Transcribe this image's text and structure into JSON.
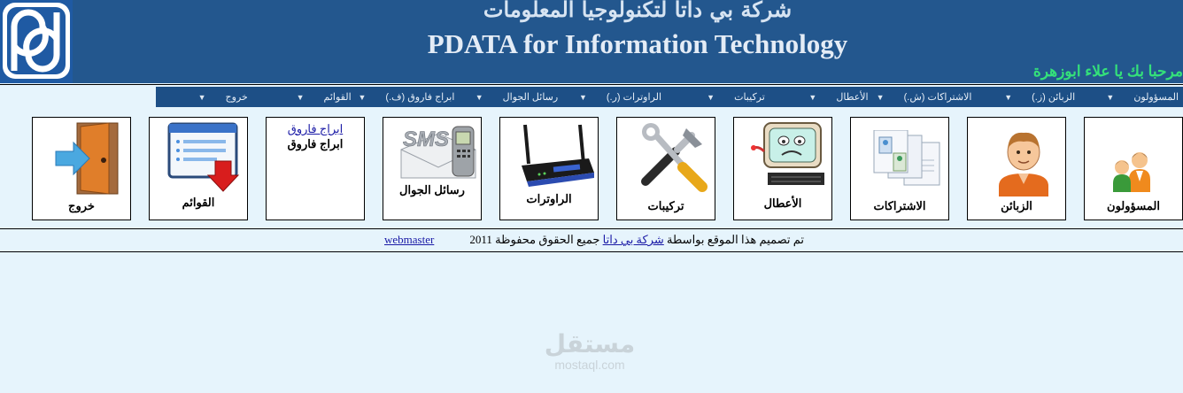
{
  "header": {
    "title_ar": "شركة بي داتا لتكنولوجيا المعلومات",
    "title_en": "PDATA for Information Technology",
    "welcome": "مرحبا بك يا علاء ابوزهرة",
    "logo_icon": "pdata-logo",
    "bg_color": "#23578e"
  },
  "menu": [
    {
      "label": "المسؤولون",
      "icon": "chevron-down-icon"
    },
    {
      "label": "الزبائن (ز.)",
      "icon": "chevron-down-icon"
    },
    {
      "label": "الاشتراكات (ش.)",
      "icon": "chevron-down-icon"
    },
    {
      "label": "الأعطال",
      "icon": "chevron-down-icon"
    },
    {
      "label": "تركيبات",
      "icon": "chevron-down-icon"
    },
    {
      "label": "الراوترات (ر.)",
      "icon": "chevron-down-icon"
    },
    {
      "label": "رسائل الجوال",
      "icon": "chevron-down-icon"
    },
    {
      "label": "ابراج فاروق (ف.)",
      "icon": "chevron-down-icon"
    },
    {
      "label": "القوائم",
      "icon": "chevron-down-icon"
    },
    {
      "label": "خروج",
      "icon": "chevron-down-icon"
    }
  ],
  "tiles": [
    {
      "label": "المسؤولون",
      "icon": "admins-icon"
    },
    {
      "label": "الزبائن",
      "icon": "customer-icon"
    },
    {
      "label": "الاشتراكات",
      "icon": "subscriptions-icon"
    },
    {
      "label": "الأعطال",
      "icon": "broken-computer-icon"
    },
    {
      "label": "تركيبات",
      "icon": "tools-icon"
    },
    {
      "label": "الراوترات",
      "icon": "router-icon"
    },
    {
      "label": "رسائل الجوال",
      "icon": "sms-icon"
    },
    {
      "label": "ابراج فاروق",
      "link": "ابراج فاروق",
      "icon": "none"
    },
    {
      "label": "القوائم",
      "icon": "lists-icon"
    },
    {
      "label": "خروج",
      "icon": "exit-door-icon"
    }
  ],
  "footer": {
    "prefix": "تم تصميم هذا الموقع بواسطة",
    "company_link": "شركة بي داتا",
    "suffix": "جميع الحقوق محفوظة 2011",
    "webmaster": "webmaster"
  },
  "watermark": {
    "ar": "مستقل",
    "en": "mostaql.com"
  }
}
